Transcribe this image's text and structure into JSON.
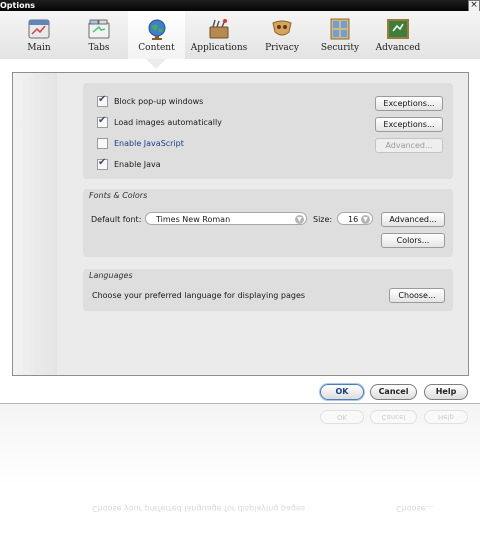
{
  "window": {
    "title": "Options",
    "close_glyph": "×"
  },
  "toolbar": {
    "tabs": [
      {
        "label": "Main",
        "icon": "main-icon"
      },
      {
        "label": "Tabs",
        "icon": "tabs-icon"
      },
      {
        "label": "Content",
        "icon": "globe-icon",
        "selected": true
      },
      {
        "label": "Applications",
        "icon": "applications-icon"
      },
      {
        "label": "Privacy",
        "icon": "privacy-icon"
      },
      {
        "label": "Security",
        "icon": "security-icon"
      },
      {
        "label": "Advanced",
        "icon": "advanced-icon"
      }
    ]
  },
  "content": {
    "options": [
      {
        "label": "Block pop-up windows",
        "checked": true,
        "button": "Exceptions...",
        "button_enabled": true
      },
      {
        "label": "Load images automatically",
        "checked": true,
        "button": "Exceptions...",
        "button_enabled": true
      },
      {
        "label": "Enable JavaScript",
        "checked": false,
        "button": "Advanced...",
        "button_enabled": false
      },
      {
        "label": "Enable Java",
        "checked": true
      }
    ],
    "fonts_colors": {
      "legend": "Fonts & Colors",
      "default_font_label": "Default font:",
      "default_font_value": "Times New Roman",
      "size_label": "Size:",
      "size_value": "16",
      "advanced_button": "Advanced...",
      "colors_button": "Colors..."
    },
    "languages": {
      "legend": "Languages",
      "description": "Choose your preferred language for displaying pages",
      "choose_button": "Choose..."
    }
  },
  "dialog_buttons": {
    "ok": "OK",
    "cancel": "Cancel",
    "help": "Help"
  },
  "colors": {
    "accent": "#4a7fbd",
    "link": "#1b3f8a"
  }
}
